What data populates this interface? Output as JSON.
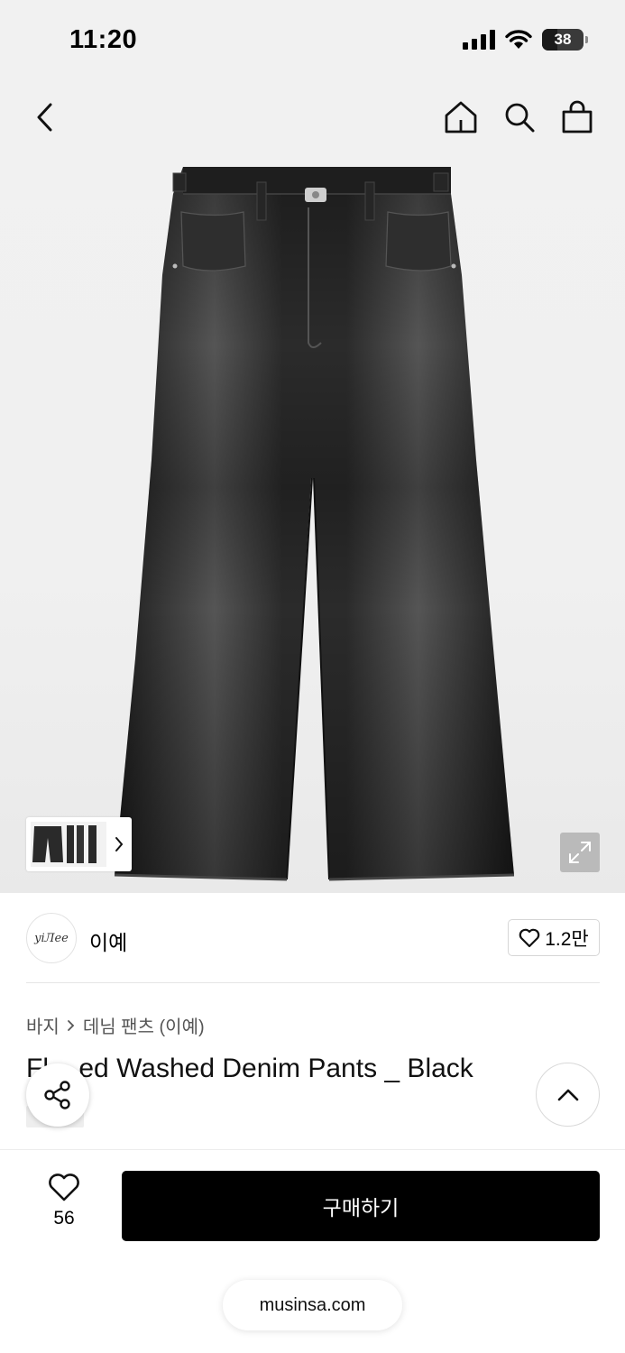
{
  "status_bar": {
    "time": "11:20",
    "battery": "38",
    "battery_level": 0.38
  },
  "nav": {
    "back_icon": "chevron-left-icon",
    "home_icon": "home-icon",
    "search_icon": "search-icon",
    "cart_icon": "shopping-bag-icon"
  },
  "gallery": {
    "expand_icon": "expand-icon",
    "thumbnails_icon": "chevron-right-icon"
  },
  "brand": {
    "logo_text": "yiЛee",
    "name": "이예",
    "likes": "1.2만"
  },
  "breadcrumb": {
    "category": "바지",
    "subcategory": "데님 팬츠 (이예)"
  },
  "product": {
    "title": "Fl__ed Washed Denim Pants _ Black"
  },
  "actions": {
    "share_icon": "share-icon",
    "scroll_top_icon": "chevron-up-icon"
  },
  "bottom": {
    "wish_count": "56",
    "buy_label": "구매하기",
    "url": "musinsa.com"
  },
  "colors": {
    "accent": "#000000",
    "background": "#f1f1f1",
    "denim": "#2a2a2a"
  }
}
